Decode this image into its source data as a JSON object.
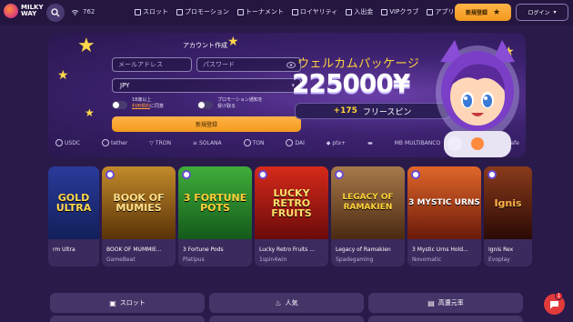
{
  "header": {
    "logo_line1": "MILKY",
    "logo_line2": "WAY",
    "online_count": "762",
    "nav": [
      "スロット",
      "プロモーション",
      "トーナメント",
      "ロイヤリティ",
      "入出金",
      "VIPクラブ",
      "アプリを取得"
    ],
    "register_label": "新規登録",
    "login_label": "ログイン"
  },
  "banner": {
    "form_title": "アカウント作成",
    "email_placeholder": "メールアドレス",
    "password_placeholder": "パスワード",
    "currency": "JPY",
    "age_line1": "18歳以上",
    "age_link": "利用規約",
    "age_line2": "に同意",
    "promo_line1": "プロモーション通知を",
    "promo_line2": "受け取る",
    "submit_label": "新規登録",
    "welcome": "ウェルカムパッケージ",
    "amount": "225000¥",
    "spins_count": "+175",
    "spins_label": "フリースピン",
    "payments": [
      "USDC",
      "tether",
      "TRON",
      "SOLANA",
      "TON",
      "DAI",
      "ptx+",
      "",
      "MULTIBANCO",
      "",
      "paysafe"
    ]
  },
  "games": [
    {
      "name": "rm Ultra",
      "provider": "",
      "art": "GOLD ULTRA",
      "bg": "#1b2a6b"
    },
    {
      "name": "BOOK OF MUMMIE...",
      "provider": "GameBeat",
      "art": "BOOK OF MUMIES",
      "bg": "#7a4a16"
    },
    {
      "name": "3 Fortune Pods",
      "provider": "Platipus",
      "art": "3 FORTUNE POTS",
      "bg": "#1f6b2a"
    },
    {
      "name": "Lucky Retro Fruits ...",
      "provider": "1spin4win",
      "art": "LUCKY RETRO FRUITS",
      "bg": "#8a1414"
    },
    {
      "name": "Legacy of Ramakien",
      "provider": "Spadegaming",
      "art": "LEGACY OF RAMAKIEN",
      "bg": "#6b4a2a"
    },
    {
      "name": "3 Mystic Urns Hold...",
      "provider": "Novomatic",
      "art": "3 MYSTIC URNS",
      "bg": "#7a2a16"
    },
    {
      "name": "Ignis Rex",
      "provider": "Evoplay",
      "art": "Ignis",
      "bg": "#5a2a1a"
    }
  ],
  "categories": [
    "スロット",
    "人気",
    "高還元率"
  ],
  "chat_badge": "1"
}
